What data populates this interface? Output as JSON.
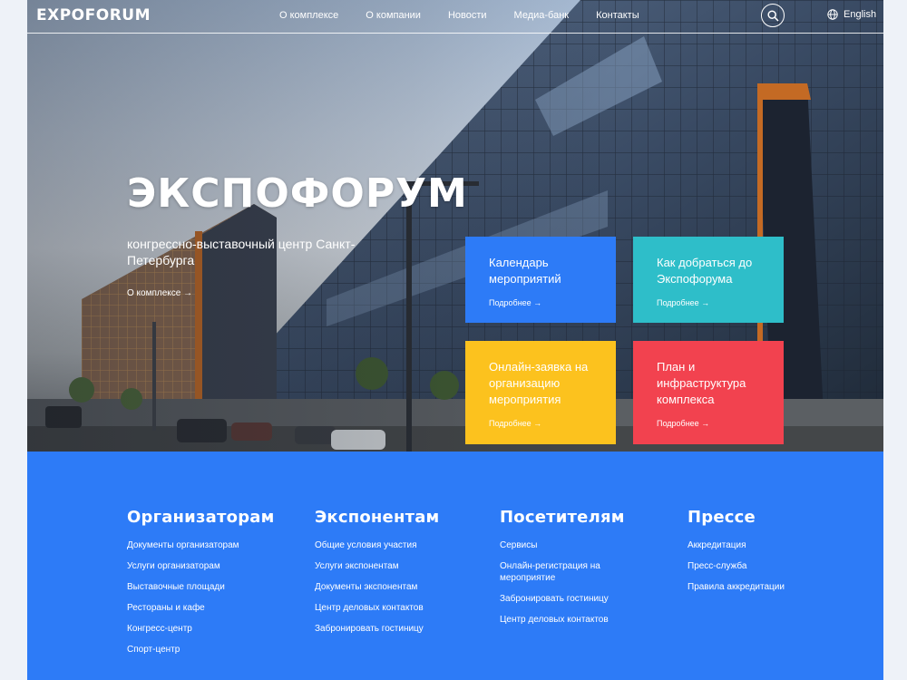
{
  "header": {
    "logo": "EXPOFORUM",
    "nav": [
      "О комплексе",
      "О компании",
      "Новости",
      "Медиа-банк",
      "Контакты"
    ],
    "language": "English"
  },
  "hero": {
    "title": "ЭКСПОФОРУМ",
    "subtitle": "конгрессно-выставочный центр Санкт-Петербурга",
    "link": "О комплексе →"
  },
  "tiles": [
    {
      "title": "Календарь мероприятий",
      "more": "Подробнее →",
      "color": "#2d7bf7"
    },
    {
      "title": "Как добраться до Экспофорума",
      "more": "Подробнее →",
      "color": "#2ebec9"
    },
    {
      "title": "Онлайн-заявка на организацию мероприятия",
      "more": "Подробнее →",
      "color": "#fcc21e"
    },
    {
      "title": "План и инфраструктура комплекса",
      "more": "Подробнее →",
      "color": "#f2424f"
    }
  ],
  "footer": {
    "accent": "#2d7bf7",
    "columns": [
      {
        "title": "Организаторам",
        "links": [
          "Документы организаторам",
          "Услуги организаторам",
          "Выставочные площади",
          "Рестораны и кафе",
          "Конгресс-центр",
          "Спорт-центр"
        ]
      },
      {
        "title": "Экспонентам",
        "links": [
          "Общие условия участия",
          "Услуги экспонентам",
          "Документы экспонентам",
          "Центр деловых контактов",
          "Забронировать гостиницу"
        ]
      },
      {
        "title": "Посетителям",
        "links": [
          "Сервисы",
          "Онлайн-регистрация на мероприятие",
          "Забронировать гостиницу",
          "Центр деловых контактов"
        ]
      },
      {
        "title": "Прессе",
        "links": [
          "Аккредитация",
          "Пресс-служба",
          "Правила аккредитации"
        ]
      }
    ]
  }
}
